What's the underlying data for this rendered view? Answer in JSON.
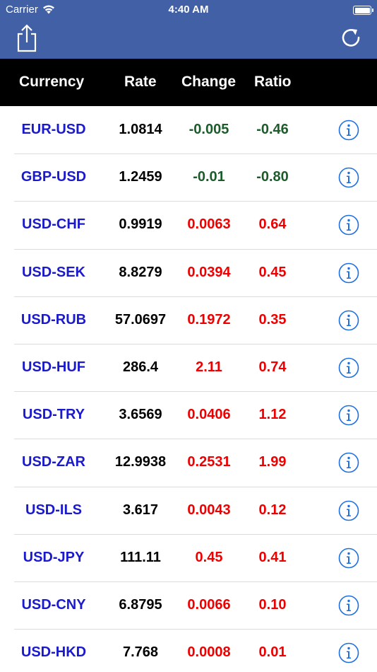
{
  "status": {
    "carrier": "Carrier",
    "time": "4:40 AM"
  },
  "toolbar": {
    "share_icon": "share-icon",
    "refresh_icon": "refresh-icon"
  },
  "columns": {
    "currency": "Currency",
    "rate": "Rate",
    "change": "Change",
    "ratio": "Ratio"
  },
  "colors": {
    "bar": "#4260a6",
    "header": "#000000",
    "pair": "#1a1acc",
    "negative": "#1c5c2a",
    "positive": "#ee0000",
    "info": "#1e6fe0"
  },
  "rows": [
    {
      "pair": "EUR-USD",
      "rate": "1.0814",
      "change": "-0.005",
      "ratio": "-0.46",
      "dir": "neg"
    },
    {
      "pair": "GBP-USD",
      "rate": "1.2459",
      "change": "-0.01",
      "ratio": "-0.80",
      "dir": "neg"
    },
    {
      "pair": "USD-CHF",
      "rate": "0.9919",
      "change": "0.0063",
      "ratio": "0.64",
      "dir": "pos"
    },
    {
      "pair": "USD-SEK",
      "rate": "8.8279",
      "change": "0.0394",
      "ratio": "0.45",
      "dir": "pos"
    },
    {
      "pair": "USD-RUB",
      "rate": "57.0697",
      "change": "0.1972",
      "ratio": "0.35",
      "dir": "pos"
    },
    {
      "pair": "USD-HUF",
      "rate": "286.4",
      "change": "2.11",
      "ratio": "0.74",
      "dir": "pos"
    },
    {
      "pair": "USD-TRY",
      "rate": "3.6569",
      "change": "0.0406",
      "ratio": "1.12",
      "dir": "pos"
    },
    {
      "pair": "USD-ZAR",
      "rate": "12.9938",
      "change": "0.2531",
      "ratio": "1.99",
      "dir": "pos"
    },
    {
      "pair": "USD-ILS",
      "rate": "3.617",
      "change": "0.0043",
      "ratio": "0.12",
      "dir": "pos"
    },
    {
      "pair": "USD-JPY",
      "rate": "111.11",
      "change": "0.45",
      "ratio": "0.41",
      "dir": "pos"
    },
    {
      "pair": "USD-CNY",
      "rate": "6.8795",
      "change": "0.0066",
      "ratio": "0.10",
      "dir": "pos"
    },
    {
      "pair": "USD-HKD",
      "rate": "7.768",
      "change": "0.0008",
      "ratio": "0.01",
      "dir": "pos"
    }
  ]
}
